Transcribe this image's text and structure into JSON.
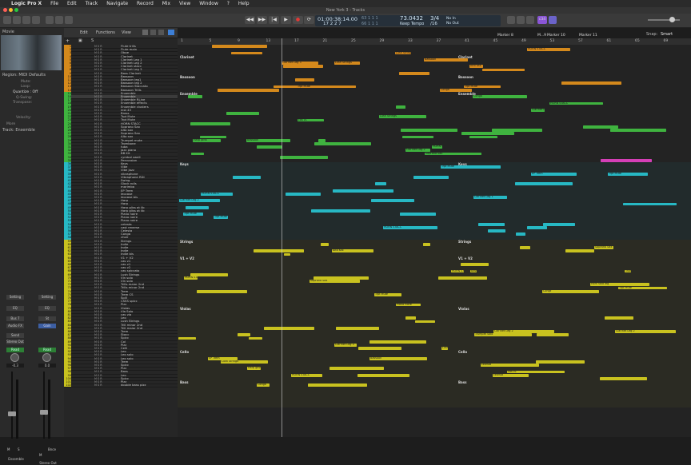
{
  "menubar": {
    "apple": "",
    "items": [
      "Logic Pro X",
      "File",
      "Edit",
      "Track",
      "Navigate",
      "Record",
      "Mix",
      "View",
      "Window",
      "?",
      "Help"
    ]
  },
  "window": {
    "title": "New York 3 - Tracks"
  },
  "lcd": {
    "position": "01:00:38:14.00",
    "bars": "17  2  2     7",
    "bars_hi": "63  1  1     1",
    "bars_lo": "66  1  1     1",
    "tempo": "73.0432",
    "tempo_label": "Keep Tempo",
    "signature": "3/4",
    "division": "/16",
    "in": "No In",
    "out": "No Out",
    "cpu": "c34"
  },
  "inspector": {
    "section_movie": "Movie",
    "region_title": "Region: MIDI Defaults",
    "rows": [
      "Mute:",
      "Loop:",
      "Quantize : Off",
      "Q-Swing:",
      "Transpose:",
      "Velocity:"
    ],
    "more": "More",
    "track_title": "Track: Ensemble",
    "strip_left": {
      "setting": "Setting",
      "eq": "EQ",
      "sends": "Bus 7",
      "audio_fx": "Audio FX",
      "send_label": "Send",
      "output": "Stereo Out",
      "mode": "Read",
      "pan": "-0.3",
      "name": "Ensemble",
      "m": "M",
      "s": "S"
    },
    "strip_right": {
      "setting": "Setting",
      "eq": "EQ",
      "sends": "St",
      "audio_fx": "Gain",
      "send_label": "Gain",
      "output": "",
      "mode": "Read",
      "pan": "0.0",
      "name": "Stereo Out",
      "extra": "Bnce",
      "m": "M"
    }
  },
  "toolbar": {
    "edit": "Edit",
    "functions": "Functions",
    "view": "View",
    "snap": "Snap:",
    "snap_value": "Smart"
  },
  "ruler": {
    "bars": [
      "1",
      "5",
      "9",
      "13",
      "17",
      "21",
      "25",
      "29",
      "33",
      "37",
      "41",
      "45",
      "49",
      "53",
      "57",
      "61",
      "65",
      "69"
    ],
    "markers": [
      "Marker 8",
      "M...9",
      "Marker 10",
      "Marker 11"
    ]
  },
  "tracks": [
    {
      "n": "",
      "name": "Flute trills"
    },
    {
      "n": "",
      "name": "Flute main"
    },
    {
      "n": "",
      "name": "Oboe"
    },
    {
      "n": "",
      "name": "Clarinet"
    },
    {
      "n": "",
      "name": "Clarinet Leg 1"
    },
    {
      "n": "",
      "name": "Clarinet Leg 2"
    },
    {
      "n": "",
      "name": "Clarinet stacc"
    },
    {
      "n": "",
      "name": "Clarinet Leg 3"
    },
    {
      "n": "",
      "name": "Bass Clarinet"
    },
    {
      "n": "",
      "name": "Bassoon"
    },
    {
      "n": "",
      "name": "Bassoon leg1"
    },
    {
      "n": "",
      "name": "Bassoon leg 2"
    },
    {
      "n": "",
      "name": "Bassoon Staccato"
    },
    {
      "n": "",
      "name": "Bassoon Trills"
    },
    {
      "n": "",
      "name": "Ensemble"
    },
    {
      "n": "",
      "name": "Ensemble"
    },
    {
      "n": "",
      "name": "Ensemble RLine"
    },
    {
      "n": "",
      "name": "Ensemble effects"
    },
    {
      "n": "",
      "name": "Ensemble clusters"
    },
    {
      "n": "",
      "name": "inst 43"
    },
    {
      "n": "",
      "name": "Brass"
    },
    {
      "n": "",
      "name": "Trpt Mute"
    },
    {
      "n": "",
      "name": "Trpt Mute"
    },
    {
      "n": "",
      "name": "HORN STACC"
    },
    {
      "n": "",
      "name": "Soprano Sax"
    },
    {
      "n": "",
      "name": "Alto sax"
    },
    {
      "n": "",
      "name": "Soprano Sax"
    },
    {
      "n": "",
      "name": "Alto sax"
    },
    {
      "n": "",
      "name": "Trumpet mute"
    },
    {
      "n": "",
      "name": "Trombone"
    },
    {
      "n": "",
      "name": "tuba"
    },
    {
      "n": "",
      "name": "jazz piano"
    },
    {
      "n": "",
      "name": "BB Kit"
    },
    {
      "n": "",
      "name": "cymbal swell"
    },
    {
      "n": "",
      "name": "Percussion"
    },
    {
      "n": "",
      "name": "Keys"
    },
    {
      "n": "",
      "name": "Vibe"
    },
    {
      "n": "",
      "name": "Vibe Jazz"
    },
    {
      "n": "",
      "name": "vibraphone"
    },
    {
      "n": "",
      "name": "Vibraphone RDI"
    },
    {
      "n": "",
      "name": "Swing"
    },
    {
      "n": "",
      "name": "Glock rolls"
    },
    {
      "n": "",
      "name": "marimba"
    },
    {
      "n": "",
      "name": "EP Trem"
    },
    {
      "n": "",
      "name": "leocase"
    },
    {
      "n": "",
      "name": "leocase bis"
    },
    {
      "n": "",
      "name": "Harp"
    },
    {
      "n": "",
      "name": "Harp"
    },
    {
      "n": "",
      "name": "Harp gliss at lib"
    },
    {
      "n": "",
      "name": "Harp gliss at lib"
    },
    {
      "n": "",
      "name": "Piano noire"
    },
    {
      "n": "",
      "name": "Piano noire"
    },
    {
      "n": "",
      "name": "Piano noire"
    },
    {
      "n": "",
      "name": "celesta"
    },
    {
      "n": "",
      "name": "cast reverse"
    },
    {
      "n": "",
      "name": "Celesta"
    },
    {
      "n": "",
      "name": "Conga"
    },
    {
      "n": "",
      "name": "choir"
    },
    {
      "n": "",
      "name": "Strings"
    },
    {
      "n": "",
      "name": "Indie"
    },
    {
      "n": "",
      "name": "Indie"
    },
    {
      "n": "",
      "name": "Indie"
    },
    {
      "n": "",
      "name": "Indie bis"
    },
    {
      "n": "",
      "name": "V1 + V2"
    },
    {
      "n": "",
      "name": "cas v1"
    },
    {
      "n": "",
      "name": "cas v1"
    },
    {
      "n": "",
      "name": "cas v2"
    },
    {
      "n": "",
      "name": "cas spiccato"
    },
    {
      "n": "",
      "name": "Lush Strings"
    },
    {
      "n": "",
      "name": "Vln solo"
    },
    {
      "n": "",
      "name": "Vln solo"
    },
    {
      "n": "",
      "name": "Trills maior 2nd"
    },
    {
      "n": "",
      "name": "Trills minor 2nd"
    },
    {
      "n": "",
      "name": "Trem"
    },
    {
      "n": "",
      "name": "Trem CS"
    },
    {
      "n": "",
      "name": "Spill"
    },
    {
      "n": "",
      "name": "CSSS spicc"
    },
    {
      "n": "",
      "name": "Pizz"
    },
    {
      "n": "",
      "name": "Violas"
    },
    {
      "n": "",
      "name": "Vla Solo"
    },
    {
      "n": "",
      "name": "cas vla"
    },
    {
      "n": "",
      "name": "Leo"
    },
    {
      "n": "",
      "name": "Lush Strings"
    },
    {
      "n": "",
      "name": "Trill minor 2nd"
    },
    {
      "n": "",
      "name": "Trill maior 2nd"
    },
    {
      "n": "",
      "name": "Trem"
    },
    {
      "n": "",
      "name": "Stacc"
    },
    {
      "n": "",
      "name": "Spicc"
    },
    {
      "n": "",
      "name": "Col"
    },
    {
      "n": "",
      "name": "Pizz"
    },
    {
      "n": "",
      "name": "Celli"
    },
    {
      "n": "",
      "name": "Leo"
    },
    {
      "n": "",
      "name": "Leo solo"
    },
    {
      "n": "",
      "name": "Leo solo"
    },
    {
      "n": "",
      "name": "Trem"
    },
    {
      "n": "",
      "name": "Spicc"
    },
    {
      "n": "",
      "name": "Pizz"
    },
    {
      "n": "",
      "name": "Bass"
    },
    {
      "n": "",
      "name": "Leo"
    },
    {
      "n": "",
      "name": "Spicc"
    },
    {
      "n": "",
      "name": "Pizz"
    },
    {
      "n": "",
      "name": "double bass pizz"
    }
  ],
  "folders": [
    "Clarinet",
    "Bassoon",
    "Ensemble",
    "Keys",
    "Strings",
    "V1 + V2",
    "Violas",
    "Cello",
    "Bass"
  ],
  "region_labels": [
    "Clarinet Leg 1",
    "Clarinet Leg 2",
    "Clarinet Leg 3",
    "Bassoon",
    "Trumpet Solo",
    "Horn solo leg",
    "Trpt Mute",
    "Soprano Sax",
    "Alto sax",
    "HORN STACC",
    "Vibe Jazz",
    "EP Trem",
    "Harp gliss",
    "Piano noire",
    "celesta",
    "Conga",
    "cas v1",
    "Lush Strings",
    "Bells"
  ],
  "colors": {
    "woodwind": "#d4891c",
    "brass": "#3fb33f",
    "keys": "#27b8c4",
    "strings": "#c9c21f",
    "perc": "#d43fb6",
    "bg": "#232323"
  }
}
